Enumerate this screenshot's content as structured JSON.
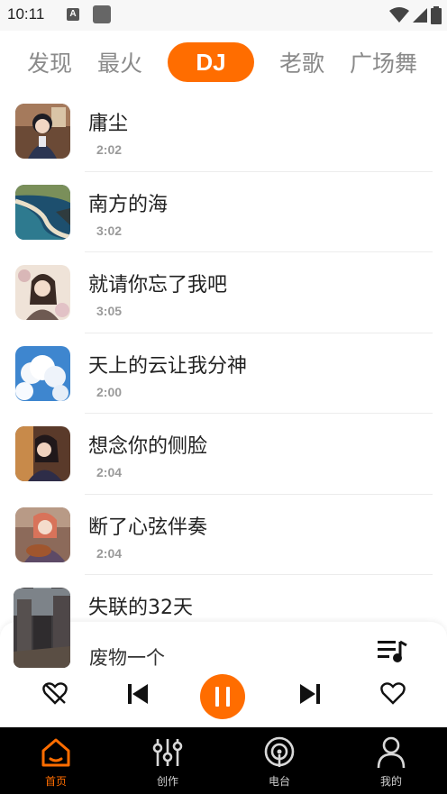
{
  "status_bar": {
    "time": "10:11",
    "notif_letter": "A"
  },
  "tabs": [
    {
      "label": "发现",
      "active": false
    },
    {
      "label": "最火",
      "active": false
    },
    {
      "label": "DJ",
      "active": true
    },
    {
      "label": "老歌",
      "active": false
    },
    {
      "label": "广场舞",
      "active": false
    }
  ],
  "songs": [
    {
      "title": "庸尘",
      "duration": "2:02",
      "cover": "girl-by-window"
    },
    {
      "title": "南方的海",
      "duration": "3:02",
      "cover": "coastline"
    },
    {
      "title": "就请你忘了我吧",
      "duration": "3:05",
      "cover": "girl-with-flowers"
    },
    {
      "title": "天上的云让我分神",
      "duration": "2:00",
      "cover": "blue-sky-clouds"
    },
    {
      "title": "想念你的侧脸",
      "duration": "2:04",
      "cover": "girl-side-face"
    },
    {
      "title": "断了心弦伴奏",
      "duration": "2:04",
      "cover": "girl-with-guitar"
    },
    {
      "title": "失联的32天",
      "duration": "",
      "cover": "street-scene"
    }
  ],
  "player": {
    "title": "废物一个",
    "icons": [
      "dislike-icon",
      "previous-icon",
      "pause-icon",
      "next-icon",
      "heart-icon",
      "playlist-icon"
    ]
  },
  "bottom_nav": [
    {
      "label": "首页",
      "icon": "home-icon",
      "active": true
    },
    {
      "label": "创作",
      "icon": "sliders-icon",
      "active": false
    },
    {
      "label": "电台",
      "icon": "radio-icon",
      "active": false
    },
    {
      "label": "我的",
      "icon": "user-icon",
      "active": false
    }
  ],
  "colors": {
    "accent": "#ff6d00",
    "nav_bg": "#000000",
    "text_muted": "#9a9a9a"
  }
}
